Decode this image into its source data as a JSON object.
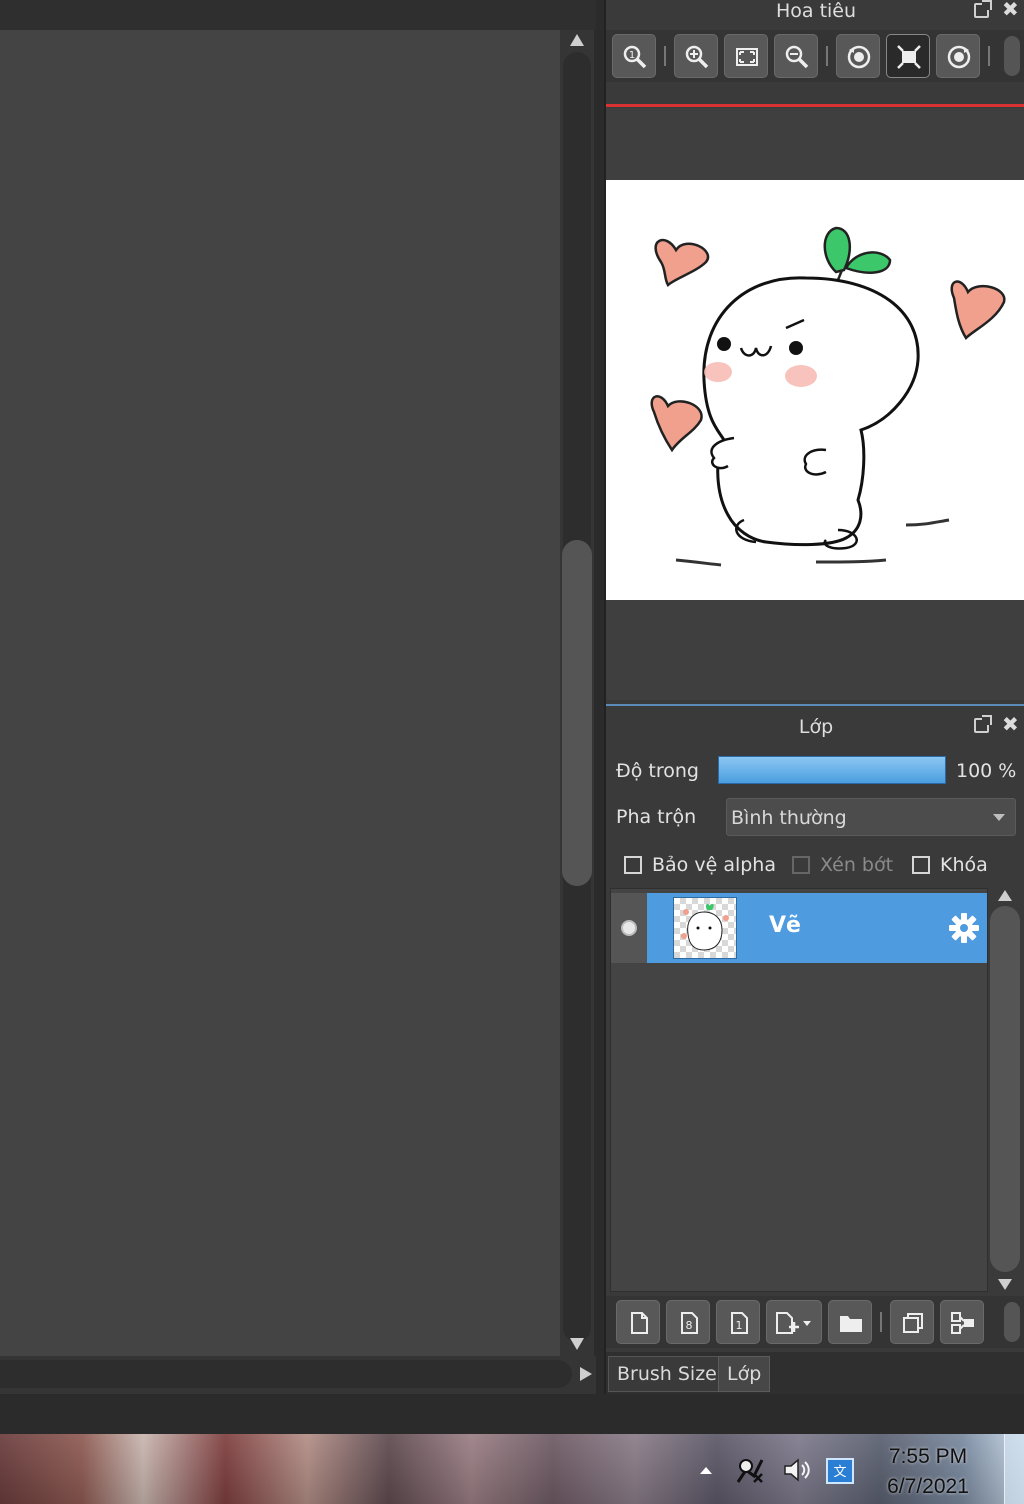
{
  "navigator": {
    "title": "Hoa tiêu",
    "toolbar_icons": [
      "zoom-reset-icon",
      "zoom-in-icon",
      "fit-screen-icon",
      "zoom-out-icon",
      "rotate-left-icon",
      "actual-size-icon",
      "rotate-right-icon"
    ]
  },
  "layers": {
    "title": "Lớp",
    "opacity_label": "Độ trong",
    "opacity_value": "100 %",
    "opacity_fraction": 1.0,
    "blend_label": "Pha trộn",
    "blend_value": "Bình thường",
    "protect_alpha_label": "Bảo vệ alpha",
    "clipping_label": "Xén bớt",
    "lock_label": "Khóa",
    "items": [
      {
        "name": "Vẽ",
        "selected": true
      }
    ],
    "toolbar_icons": [
      "new-layer-icon",
      "new-8bit-layer-icon",
      "new-1bit-layer-icon",
      "add-layer-dropdown-icon",
      "new-folder-icon",
      "duplicate-layer-icon",
      "merge-layer-icon"
    ]
  },
  "dock_tabs": [
    "Brush Size",
    "Lớp"
  ],
  "taskbar": {
    "time": "7:55 PM",
    "date": "6/7/2021"
  },
  "colors": {
    "accent_blue": "#4f9be0",
    "navigator_red_line": "#d83232",
    "heart": "#f0a08c",
    "sprout": "#3cc86a"
  }
}
